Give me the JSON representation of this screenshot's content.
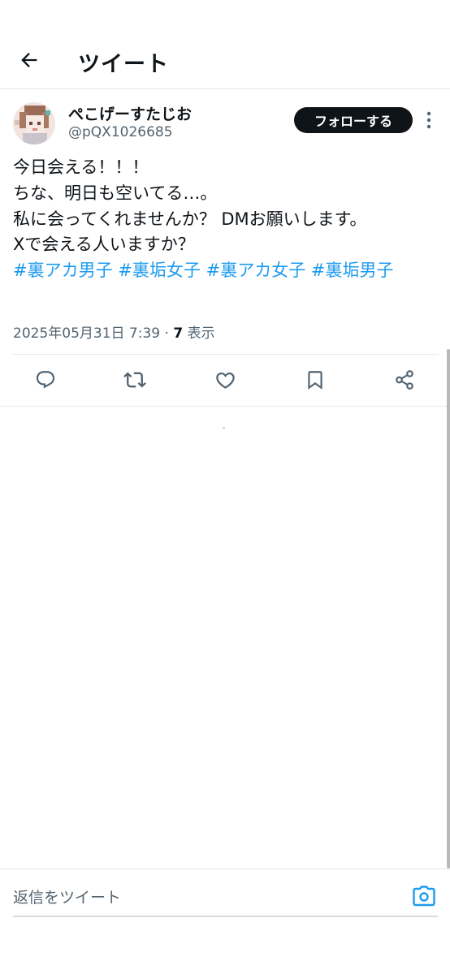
{
  "header": {
    "title": "ツイート",
    "back_icon": "arrow-left-icon"
  },
  "author": {
    "name": "ぺこげーすたじお",
    "handle": "@pQX1026685",
    "follow_label": "フォローする",
    "more_icon": "more-vertical-icon"
  },
  "tweet": {
    "lines": [
      "今日会える！！！",
      "ちな、明日も空いてる…。",
      "私に会ってくれませんか？ DMお願いします。",
      "Xで会える人いますか？"
    ],
    "hashtags": [
      "#裏アカ男子",
      "#裏垢女子",
      "#裏アカ女子",
      "#裏垢男子"
    ],
    "timestamp": "2025年05月31日 7:39",
    "separator": " · ",
    "views_count": "7",
    "views_label": " 表示"
  },
  "actions": [
    {
      "icon": "reply-icon"
    },
    {
      "icon": "retweet-icon"
    },
    {
      "icon": "like-icon"
    },
    {
      "icon": "bookmark-icon"
    },
    {
      "icon": "share-icon"
    }
  ],
  "reply": {
    "placeholder": "返信をツイート",
    "camera_icon": "camera-icon"
  },
  "colors": {
    "text": "#0f1419",
    "secondary": "#536471",
    "accent": "#1d9bf0",
    "follow_bg": "#0f1419",
    "border": "#e7e9ea"
  }
}
